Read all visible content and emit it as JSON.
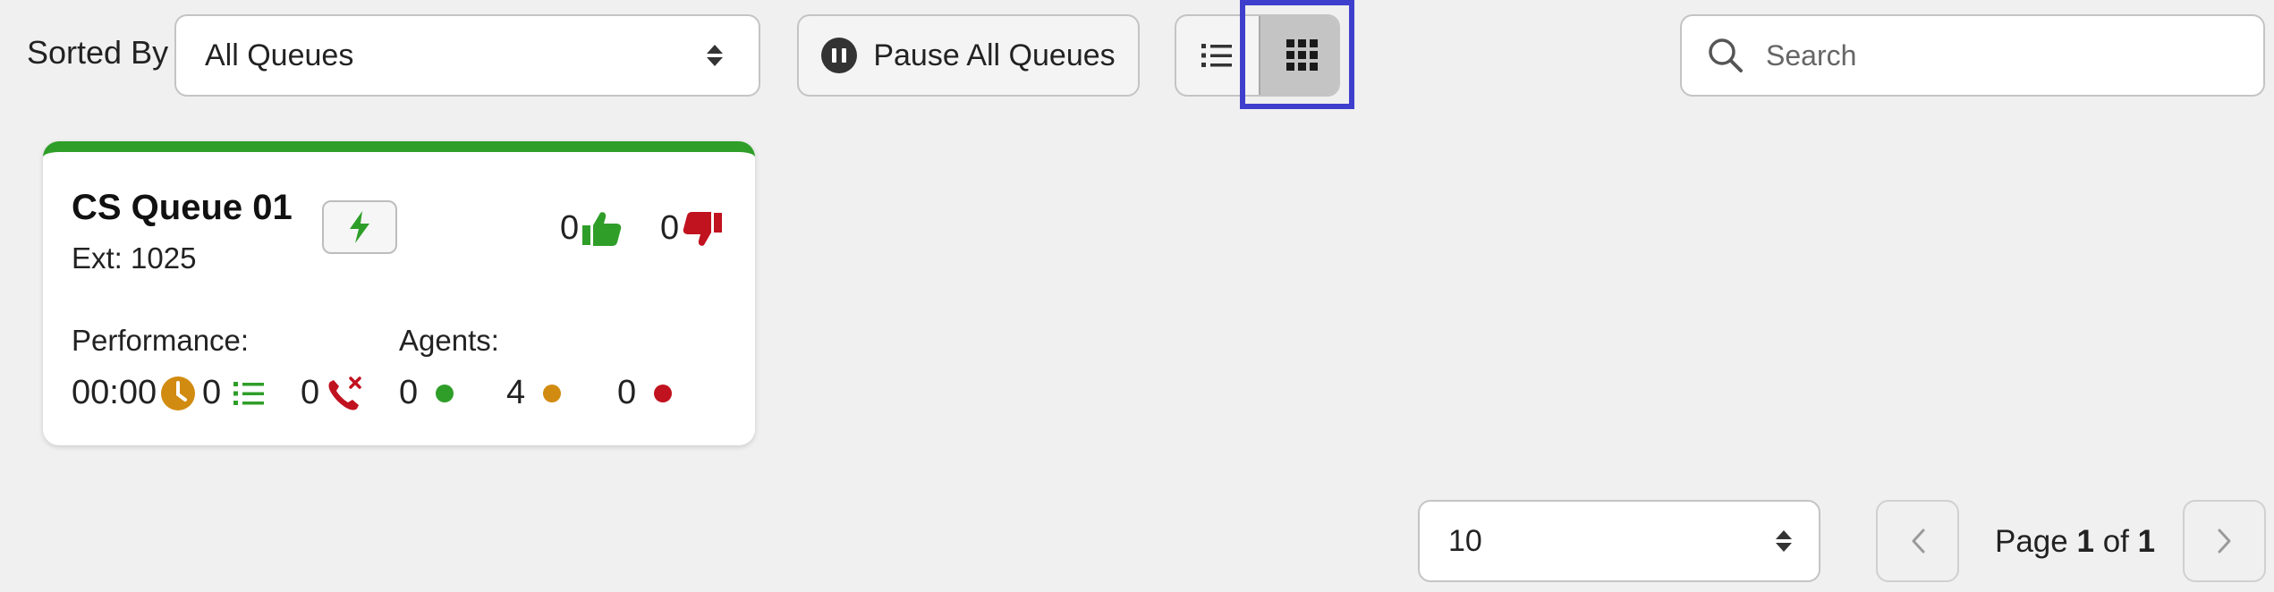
{
  "toolbar": {
    "sorted_by_label": "Sorted By",
    "sort_value": "All Queues",
    "pause_label": "Pause All Queues",
    "search_placeholder": "Search",
    "active_view": "grid"
  },
  "queue_card": {
    "name": "CS Queue 01",
    "ext": "Ext: 1025",
    "likes": "0",
    "dislikes": "0",
    "performance_label": "Performance:",
    "agents_label": "Agents:",
    "wait_time": "00:00",
    "queued": "0",
    "missed": "0",
    "agents_available": "0",
    "agents_busy": "4",
    "agents_offline": "0",
    "accent_color": "#2f9e29"
  },
  "pagination": {
    "page_size": "10",
    "page_word": "Page",
    "current": "1",
    "of_word": "of",
    "total": "1"
  },
  "colors": {
    "green": "#2f9e29",
    "amber": "#d18b10",
    "red": "#c1121f",
    "highlight": "#3f3fce"
  }
}
